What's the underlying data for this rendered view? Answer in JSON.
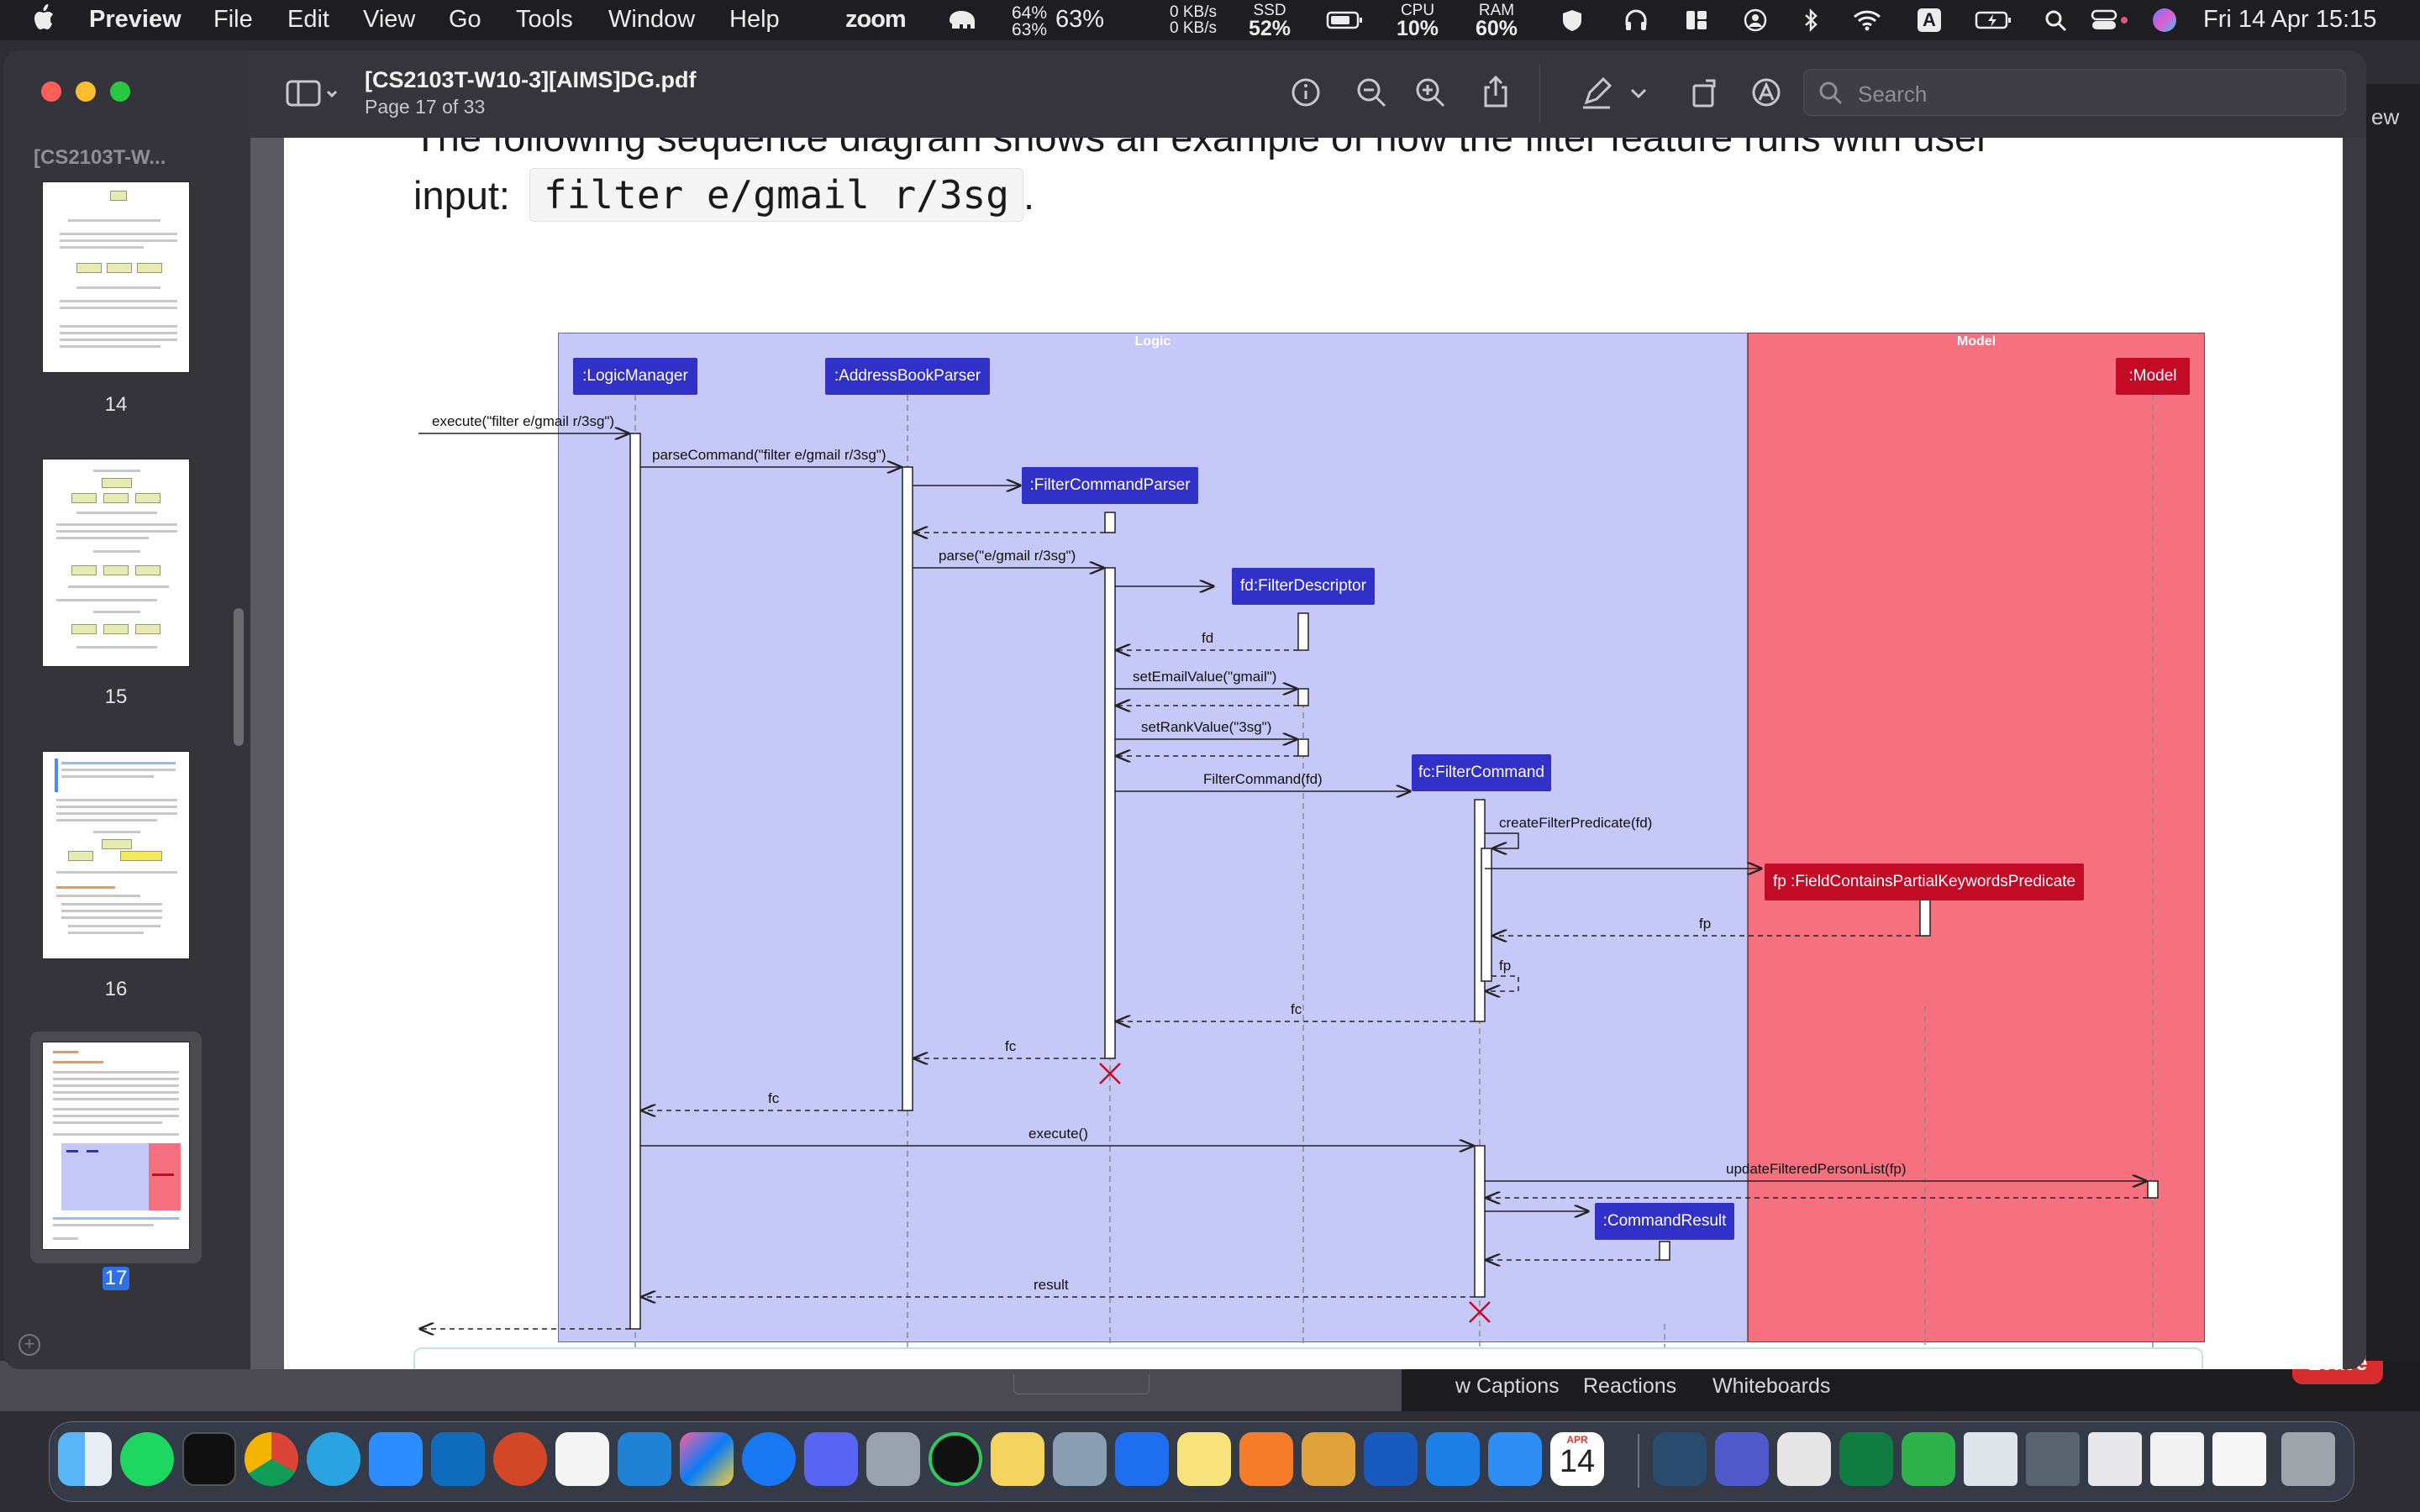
{
  "menubar": {
    "app": "Preview",
    "items": [
      "File",
      "Edit",
      "View",
      "Go",
      "Tools",
      "Window",
      "Help"
    ],
    "zoom": "zoom",
    "battery_pct_top": "64%",
    "battery_pct_bottom": "63%",
    "battery_pct": "63%",
    "net_up": "0 KB/s",
    "net_down": "0 KB/s",
    "ssd_label": "SSD",
    "ssd_value": "52%",
    "cpu_label": "CPU",
    "cpu_value": "10%",
    "ram_label": "RAM",
    "ram_value": "60%",
    "input_source": "A",
    "datetime": "Fri 14 Apr  15:15"
  },
  "window": {
    "title": "[CS2103T-W10-3][AIMS]DG.pdf",
    "subtitle": "Page 17 of 33",
    "sidebar_title": "[CS2103T-W...",
    "search_placeholder": "Search",
    "right_peek": "ew"
  },
  "thumbnails": [
    {
      "page": "14"
    },
    {
      "page": "15"
    },
    {
      "page": "16"
    },
    {
      "page": "17"
    }
  ],
  "document": {
    "intro_line1": "The following sequence diagram shows an example of how the filter feature runs with user",
    "intro_prefix": "input:",
    "intro_code": "filter e/gmail r/3sg",
    "intro_suffix": "."
  },
  "diagram": {
    "logic_label": "Logic",
    "model_label": "Model",
    "participants": [
      ":LogicManager",
      ":AddressBookParser",
      ":FilterCommandParser",
      "fd:FilterDescriptor",
      "fc:FilterCommand",
      ":CommandResult",
      "fp :FieldContainsPartialKeywordsPredicate",
      ":Model"
    ],
    "messages": [
      "execute(\"filter e/gmail r/3sg\")",
      "parseCommand(\"filter e/gmail r/3sg\")",
      "parse(\"e/gmail r/3sg\")",
      "fd",
      "setEmailValue(\"gmail\")",
      "setRankValue(\"3sg\")",
      "FilterCommand(fd)",
      "createFilterPredicate(fd)",
      "fp",
      "fp",
      "fc",
      "fc",
      "fc",
      "execute()",
      "updateFilteredPersonList(fp)",
      "result"
    ],
    "colors": {
      "logic_bg": "#c6c8f7",
      "model_bg": "#f7707f",
      "logic_box": "#3131c8",
      "model_box": "#c30a26"
    }
  },
  "zoom_meeting": {
    "buttons": [
      "w Captions",
      "Reactions",
      "Whiteboards"
    ],
    "leave": "Leave"
  },
  "dock": {
    "calendar_month": "APR",
    "calendar_day": "14"
  }
}
